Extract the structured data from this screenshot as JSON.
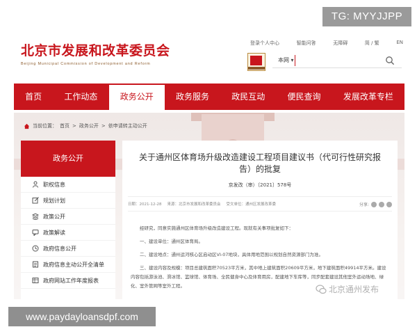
{
  "watermark_top": "TG: MYYJJPP",
  "site": {
    "title": "北京市发展和改革委员会",
    "subtitle": "Beijing Municipal Commission of Development and Reform"
  },
  "top_links": [
    "登录个人中心",
    "智能问答",
    "无障碍",
    "简 / 繁",
    "EN"
  ],
  "search": {
    "scope_label": "本网 ▾",
    "placeholder": "",
    "icon": "search-icon"
  },
  "nav": {
    "items": [
      "首页",
      "工作动态",
      "政务公开",
      "政务服务",
      "政民互动",
      "便民查询",
      "发展改革专栏"
    ],
    "active_index": 2
  },
  "breadcrumb": {
    "label": "当前位置：",
    "items": [
      "首页",
      "政务公开",
      "依申请转主动公开"
    ],
    "separator": ">"
  },
  "sidebar": {
    "heading": "政务公开",
    "items": [
      {
        "label": "职权信息",
        "icon": "person-icon"
      },
      {
        "label": "规划计划",
        "icon": "edit-icon"
      },
      {
        "label": "政策公开",
        "icon": "stack-icon"
      },
      {
        "label": "政策解读",
        "icon": "chat-icon"
      },
      {
        "label": "政府信息公开",
        "icon": "clock-icon"
      },
      {
        "label": "政府信息主动公开全清单",
        "icon": "list-icon"
      },
      {
        "label": "政府网站工作年度报表",
        "icon": "table-icon"
      }
    ]
  },
  "article": {
    "title": "关于通州区体育场升级改造建设工程项目建议书（代可行性研究报告）的批复",
    "doc_number": "京发改（审）〔2021〕578号",
    "meta": {
      "date": "日期：2021-12-28",
      "source": "来源：北京市发展和改革委员会",
      "doc_source": "受文单位：通州区发展改革委"
    },
    "share_label": "分享:",
    "paragraphs": [
      "经研究，同意实施通州区体育场升级改造建设工程。现就有关事项批复如下：",
      "一、建设单位：通州区体育局。",
      "二、建设地点：通州运河核心区启动区VI-07地块，具体用地范围以规划自然资源部门为准。",
      "三、建设内容及规模：项目总建筑面积70523平方米，其中地上建筑面积20609平方米，地下建筑面积49914平方米。建设内容包括游泳池、滑冰馆、篮球馆、体育场、全民健身中心及体育用房，配建地下车库等，同步配套建设其他室外运动场地、绿化、室外管网等室外工程。"
    ]
  },
  "wechat_watermark": "北京通州发布",
  "url_watermark": "www.paydayloansdpf.com",
  "colors": {
    "brand_red": "#c8161d",
    "watermark_gray": "#9a9a9a"
  }
}
